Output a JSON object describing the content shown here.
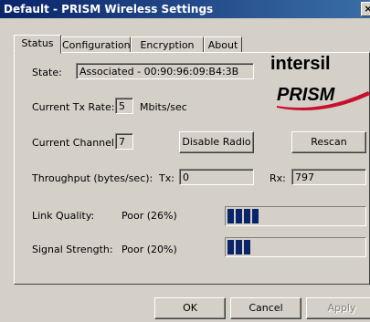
{
  "window": {
    "title": "Default - PRISM Wireless Settings",
    "close_glyph": "×"
  },
  "tabs": [
    "Status",
    "Configuration",
    "Encryption",
    "About"
  ],
  "status": {
    "state_label": "State:",
    "state_value": "Associated - 00:90:96:09:B4:3B",
    "tx_rate_label": "Current Tx Rate:",
    "tx_rate_value": "5",
    "tx_rate_unit": "Mbits/sec",
    "channel_label": "Current Channel:",
    "channel_value": "7",
    "disable_radio": "Disable Radio",
    "rescan": "Rescan",
    "throughput_label": "Throughput (bytes/sec):",
    "tx_label": "Tx:",
    "tx_value": "0",
    "rx_label": "Rx:",
    "rx_value": "797",
    "link_quality_label": "Link Quality:",
    "link_quality_value": "Poor (26%)",
    "link_quality_percent": 26,
    "signal_strength_label": "Signal Strength:",
    "signal_strength_value": "Poor (20%)",
    "signal_strength_percent": 20
  },
  "logos": {
    "intersil": "intersil",
    "prism": "PRISM"
  },
  "buttons": {
    "ok": "OK",
    "cancel": "Cancel",
    "apply": "Apply"
  },
  "colors": {
    "title_bar": "#0a246a",
    "bar_fill": "#0a246a",
    "prism_red": "#c8102e"
  }
}
